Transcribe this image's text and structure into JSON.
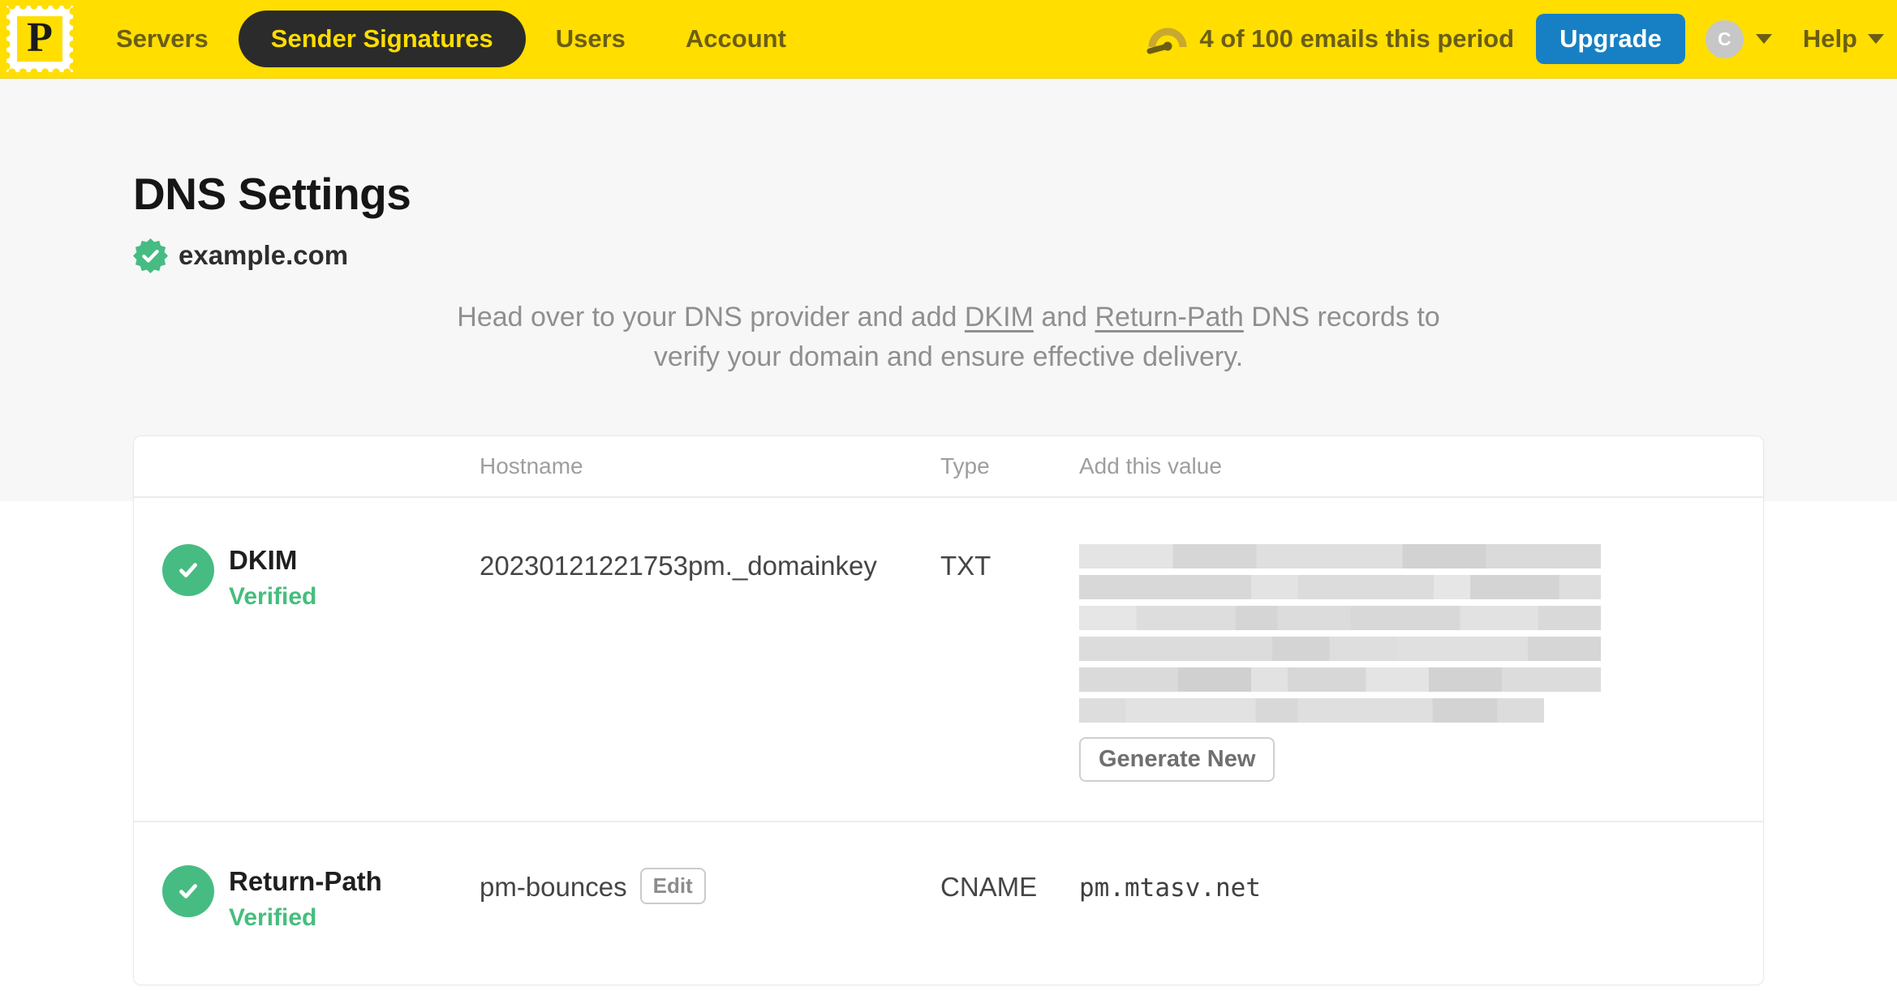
{
  "nav": {
    "logo_letter": "P",
    "items": [
      {
        "label": "Servers",
        "active": false
      },
      {
        "label": "Sender Signatures",
        "active": true
      },
      {
        "label": "Users",
        "active": false
      },
      {
        "label": "Account",
        "active": false
      }
    ],
    "usage_text": "4 of 100 emails this period",
    "upgrade_label": "Upgrade",
    "avatar_initial": "C",
    "help_label": "Help"
  },
  "page": {
    "title": "DNS Settings",
    "domain": "example.com",
    "intro": {
      "line1_pre": "Head over to your DNS provider and add ",
      "dkim_link": "DKIM",
      "line1_mid": " and ",
      "return_path_link": "Return-Path",
      "line1_post": " DNS records to",
      "line2": "verify your domain and ensure effective delivery."
    }
  },
  "table": {
    "headers": {
      "hostname": "Hostname",
      "type": "Type",
      "value": "Add this value"
    },
    "rows": [
      {
        "name": "DKIM",
        "status": "Verified",
        "hostname": "20230121221753pm._domainkey",
        "type": "TXT",
        "value_redacted": true,
        "action_label": "Generate New"
      },
      {
        "name": "Return-Path",
        "status": "Verified",
        "hostname": "pm-bounces",
        "edit_label": "Edit",
        "type": "CNAME",
        "value": "pm.mtasv.net"
      }
    ]
  },
  "colors": {
    "brand_yellow": "#FFDE00",
    "nav_text_olive": "#6B5E14",
    "active_pill_bg": "#2B2B2B",
    "upgrade_blue": "#1780C4",
    "verified_green": "#45BE7D",
    "intro_gray": "#8F8F8F"
  }
}
